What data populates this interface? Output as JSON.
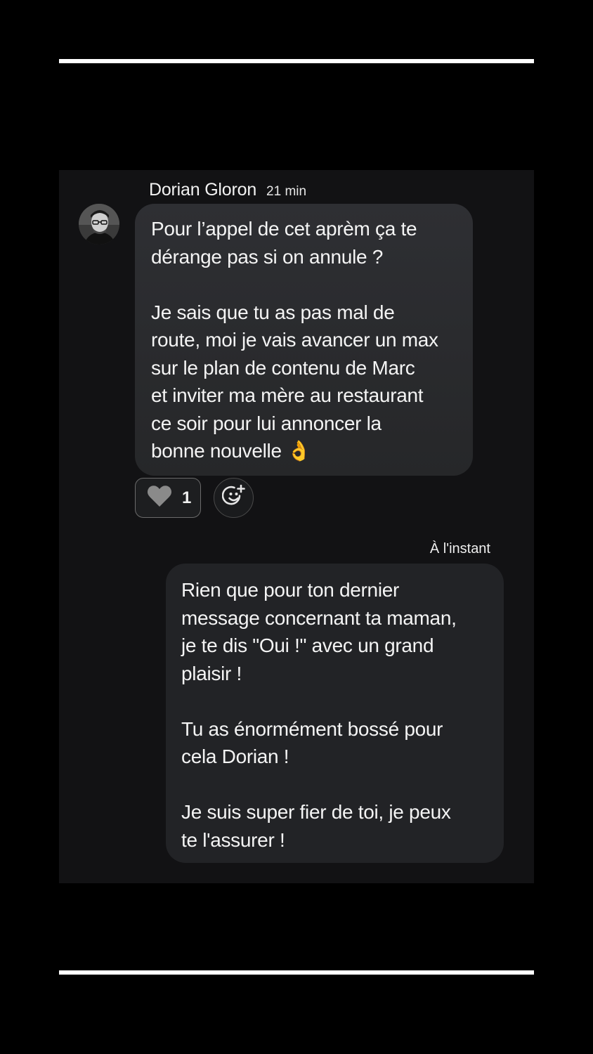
{
  "incoming": {
    "sender_name": "Dorian Gloron",
    "time": "21 min",
    "paragraphs": [
      "Pour l’appel de cet aprèm ça te\ndérange pas si on annule ?",
      "Je sais que tu as pas mal de\nroute, moi je vais avancer un max\nsur le plan de contenu de Marc\net inviter ma mère au restaurant\nce soir pour lui annoncer la\nbonne nouvelle 👌"
    ],
    "reaction": {
      "icon": "heart-icon",
      "count": "1"
    },
    "add_reaction_icon": "add-reaction-icon"
  },
  "outgoing": {
    "time": "À l'instant",
    "paragraphs": [
      "Rien que pour ton dernier\nmessage concernant ta maman,\nje te dis \"Oui !\" avec un grand\nplaisir !",
      "Tu as énormément bossé pour\ncela Dorian !",
      "Je suis super fier de toi, je peux\nte l'assurer !"
    ]
  },
  "colors": {
    "background": "#000000",
    "panel": "#121214",
    "bubble_in": "#2a2b2e",
    "bubble_out": "#222326",
    "heart": "#8a8a8a"
  }
}
